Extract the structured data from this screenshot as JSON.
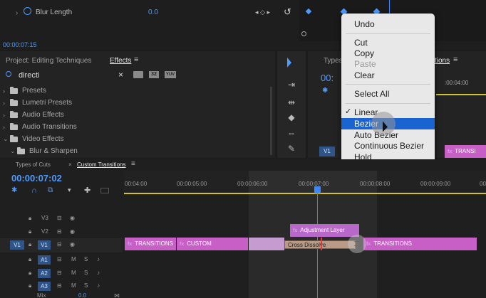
{
  "effect_controls": {
    "param_label": "Blur Length",
    "param_value": "0.0",
    "timecode": "00:00:07:15"
  },
  "project_panel": {
    "tab_project": "Project: Editing Techniques",
    "tab_effects": "Effects",
    "search_value": "directi",
    "badges": [
      "32",
      "YUV"
    ],
    "tree": [
      {
        "label": "Presets",
        "expanded": false
      },
      {
        "label": "Lumetri Presets",
        "expanded": false
      },
      {
        "label": "Audio Effects",
        "expanded": false
      },
      {
        "label": "Audio Transitions",
        "expanded": false
      },
      {
        "label": "Video Effects",
        "expanded": true
      },
      {
        "label": "Blur & Sharpen",
        "expanded": true
      }
    ]
  },
  "program_monitor": {
    "tab_partial": "Types",
    "tab_transitions": "tions",
    "timecode_partial": "00:",
    "ruler_time": ":00:04:00",
    "clip_label": "TRANSI",
    "v1": "V1"
  },
  "context_menu": {
    "items": [
      {
        "label": "Undo",
        "enabled": true
      },
      {
        "label": "Cut",
        "enabled": true
      },
      {
        "label": "Copy",
        "enabled": true
      },
      {
        "label": "Paste",
        "enabled": false
      },
      {
        "label": "Clear",
        "enabled": true
      },
      {
        "label": "Select All",
        "enabled": true
      },
      {
        "label": "Linear",
        "enabled": true,
        "checked": true
      },
      {
        "label": "Bezier",
        "enabled": true,
        "highlighted": true
      },
      {
        "label": "Auto Bezier",
        "enabled": true
      },
      {
        "label": "Continuous Bezier",
        "enabled": true
      },
      {
        "label": "Hold",
        "enabled": true
      }
    ],
    "check_mark": "✓"
  },
  "timeline": {
    "tab_cuts": "Types of Cuts",
    "tab_custom": "Custom Transitions",
    "timecode": "00:00:07:02",
    "ruler": [
      "00:04:00",
      "00:00:05:00",
      "00:00:06:00",
      "00:00:07:00",
      "00:00:08:00",
      "00:00:09:00",
      "00"
    ],
    "tracks": [
      "V3",
      "V2",
      "V1",
      "A1",
      "A2",
      "A3"
    ],
    "track_letters": {
      "mute": "M",
      "solo": "S"
    },
    "source_patch": "V1",
    "mix_label": "Mix",
    "mix_value": "0.0",
    "clips": {
      "adjustment": "Adjustment Layer",
      "transitions_left": "TRANSITIONS",
      "custom": "CUSTOM",
      "cross_dissolve": "Cross Dissolve",
      "transitions_right": "TRANSITIONS"
    },
    "fx_badge": "fx"
  },
  "colors": {
    "accent_blue": "#4d9bff",
    "clip_pink": "#c75fc7",
    "adjustment_purple": "#b868c8",
    "menu_highlight": "#1b63d0",
    "playhead": "#3b88ff"
  }
}
